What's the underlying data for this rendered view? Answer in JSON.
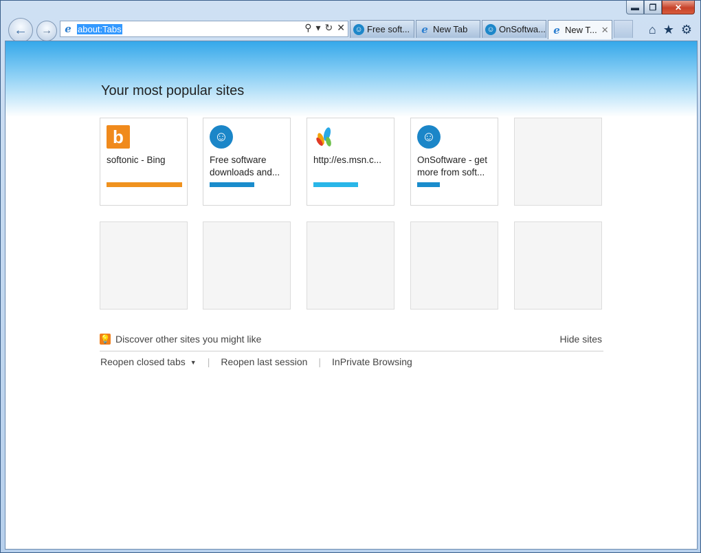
{
  "window": {
    "caption_minimize": "▬",
    "caption_restore": "❐",
    "caption_close": "✕"
  },
  "address_bar": {
    "url": "about:Tabs",
    "search_glyph": "⚲",
    "dropdown_glyph": "▾",
    "refresh_glyph": "↻",
    "stop_glyph": "✕"
  },
  "nav": {
    "back_glyph": "←",
    "forward_glyph": "→"
  },
  "tabs": [
    {
      "label": "Free soft...",
      "icon": "softonic-icon"
    },
    {
      "label": "New Tab",
      "icon": "ie-icon"
    },
    {
      "label": "OnSoftwa...",
      "icon": "softonic-icon"
    },
    {
      "label": "New T...",
      "icon": "ie-icon",
      "active": true,
      "close": "✕"
    }
  ],
  "toolbar": {
    "home_glyph": "⌂",
    "favorites_glyph": "★",
    "tools_glyph": "⚙"
  },
  "page": {
    "heading": "Your most popular sites",
    "tiles": [
      {
        "title": "softonic - Bing",
        "icon": "bing-icon",
        "bar_color": "#f0921e",
        "activity": 1.0
      },
      {
        "title": "Free software downloads and...",
        "icon": "softonic-icon",
        "bar_color": "#1a8ccc",
        "activity": 0.59
      },
      {
        "title": "http://es.msn.c...",
        "icon": "msn-icon",
        "bar_color": "#29b6e8",
        "activity": 0.59
      },
      {
        "title": "OnSoftware - get more from soft...",
        "icon": "softonic-icon",
        "bar_color": "#1a8ccc",
        "activity": 0.3
      }
    ],
    "discover_text": "Discover other sites you might like",
    "hide_sites": "Hide sites",
    "reopen_closed_tabs": "Reopen closed tabs",
    "reopen_last_session": "Reopen last session",
    "inprivate": "InPrivate Browsing",
    "separator": "|"
  }
}
